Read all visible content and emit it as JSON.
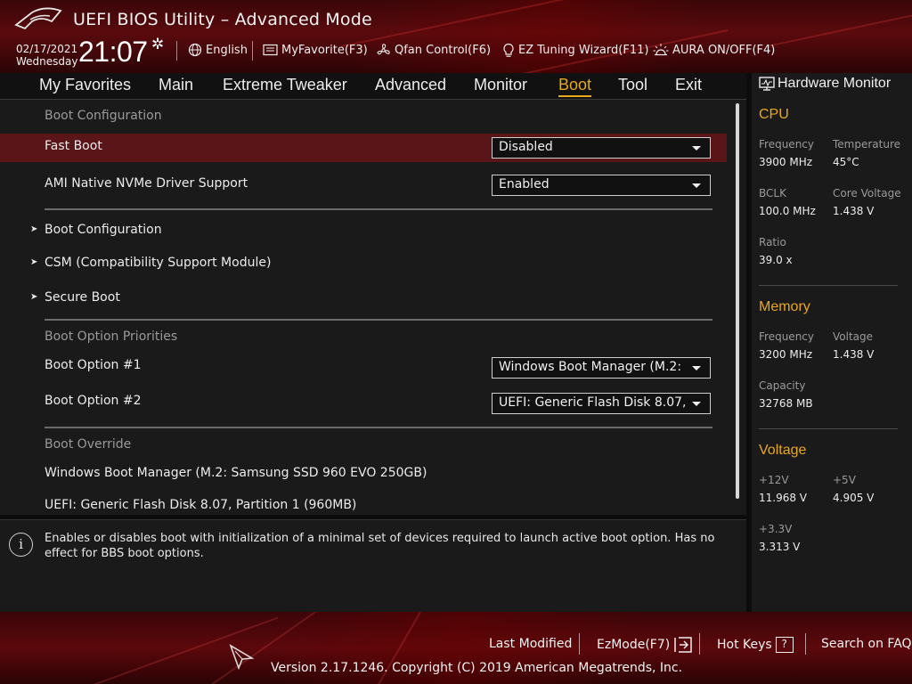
{
  "header": {
    "title": "UEFI BIOS Utility – Advanced Mode",
    "date": "02/17/2021",
    "day": "Wednesday",
    "time": "21:07",
    "language": "English",
    "myfavorite": "MyFavorite(F3)",
    "qfan": "Qfan Control(F6)",
    "ez_tuning": "EZ Tuning Wizard(F11)",
    "aura": "AURA ON/OFF(F4)"
  },
  "nav": {
    "tabs": [
      "My Favorites",
      "Main",
      "Extreme Tweaker",
      "Advanced",
      "Monitor",
      "Boot",
      "Tool",
      "Exit"
    ],
    "active": "Boot"
  },
  "boot": {
    "section_config": "Boot Configuration",
    "fast_boot": {
      "label": "Fast Boot",
      "value": "Disabled"
    },
    "nvme": {
      "label": "AMI Native NVMe Driver Support",
      "value": "Enabled"
    },
    "submenus": [
      "Boot Configuration",
      "CSM (Compatibility Support Module)",
      "Secure Boot"
    ],
    "section_priorities": "Boot Option Priorities",
    "option1": {
      "label": "Boot Option #1",
      "value": "Windows Boot Manager (M.2: Samsung SSD 960 EVO 250GB)"
    },
    "option2": {
      "label": "Boot Option #2",
      "value": "UEFI: Generic Flash Disk 8.07, Partition 1 (960MB)"
    },
    "section_override": "Boot Override",
    "override_items": [
      "Windows Boot Manager (M.2: Samsung SSD 960 EVO 250GB)",
      "UEFI: Generic Flash Disk 8.07, Partition 1 (960MB)"
    ]
  },
  "help": {
    "text": "Enables or disables boot with initialization of a minimal set of devices required to launch active boot option. Has no effect for BBS boot options."
  },
  "hw": {
    "title": "Hardware Monitor",
    "cpu": {
      "heading": "CPU",
      "frequency_label": "Frequency",
      "frequency": "3900 MHz",
      "temperature_label": "Temperature",
      "temperature": "45°C",
      "bclk_label": "BCLK",
      "bclk": "100.0 MHz",
      "core_voltage_label": "Core Voltage",
      "core_voltage": "1.438 V",
      "ratio_label": "Ratio",
      "ratio": "39.0 x"
    },
    "memory": {
      "heading": "Memory",
      "frequency_label": "Frequency",
      "frequency": "3200 MHz",
      "voltage_label": "Voltage",
      "voltage": "1.438 V",
      "capacity_label": "Capacity",
      "capacity": "32768 MB"
    },
    "voltage": {
      "heading": "Voltage",
      "v12_label": "+12V",
      "v12": "11.968 V",
      "v5_label": "+5V",
      "v5": "4.905 V",
      "v33_label": "+3.3V",
      "v33": "3.313 V"
    }
  },
  "footer": {
    "last_modified": "Last Modified",
    "ezmode": "EzMode(F7)",
    "hotkeys": "Hot Keys",
    "hotkeys_key": "?",
    "faq": "Search on FAQ",
    "version": "Version 2.17.1246. Copyright (C) 2019 American Megatrends, Inc."
  },
  "colors": {
    "accent": "#e8a81a",
    "highlight_row": "#5a1518",
    "brand_red": "#5a0a0d"
  }
}
